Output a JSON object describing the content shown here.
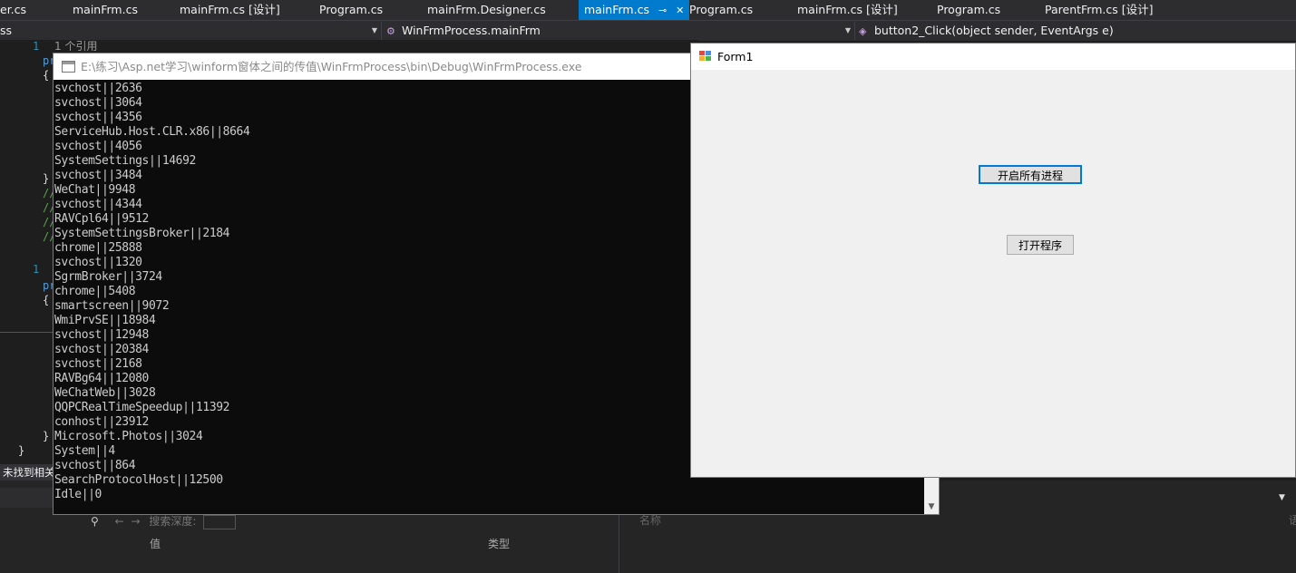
{
  "tabs": [
    {
      "label": "er.cs"
    },
    {
      "label": "mainFrm.cs"
    },
    {
      "label": "mainFrm.cs [设计]"
    },
    {
      "label": "Program.cs"
    },
    {
      "label": "mainFrm.Designer.cs"
    },
    {
      "label": "mainFrm.cs",
      "active": true
    },
    {
      "label": "Program.cs"
    },
    {
      "label": "mainFrm.cs [设计]"
    },
    {
      "label": "Program.cs"
    },
    {
      "label": "ParentFrm.cs [设计]"
    }
  ],
  "tab_pin_icon": "⊸",
  "tab_close_icon": "✕",
  "navbar": {
    "project": "ss",
    "type": "WinFrmProcess.mainFrm",
    "member": "button2_Click(object sender, EventArgs e)"
  },
  "editor": {
    "ref_text": "1 个引用",
    "line_numbers": [
      "1",
      "1"
    ],
    "fragments": [
      "pr",
      "{",
      "}",
      "//",
      "//",
      "//",
      "//",
      "pr",
      "{",
      "}",
      "}"
    ]
  },
  "status_left": "未找到相关",
  "lower_panel": {
    "search_depth_label": "搜索深度:",
    "col_value": "值",
    "col_type": "类型",
    "col_name": "名称",
    "col_lang": "语"
  },
  "console": {
    "title": "E:\\练习\\Asp.net学习\\winform窗体之间的传值\\WinFrmProcess\\bin\\Debug\\WinFrmProcess.exe",
    "lines": [
      "svchost||2636",
      "svchost||3064",
      "svchost||4356",
      "ServiceHub.Host.CLR.x86||8664",
      "svchost||4056",
      "SystemSettings||14692",
      "svchost||3484",
      "WeChat||9948",
      "svchost||4344",
      "RAVCpl64||9512",
      "SystemSettingsBroker||2184",
      "chrome||25888",
      "svchost||1320",
      "SgrmBroker||3724",
      "chrome||5408",
      "smartscreen||9072",
      "WmiPrvSE||18984",
      "svchost||12948",
      "svchost||20384",
      "svchost||2168",
      "RAVBg64||12080",
      "WeChatWeb||3028",
      "QQPCRealTimeSpeedup||11392",
      "conhost||23912",
      "Microsoft.Photos||3024",
      "System||4",
      "svchost||864",
      "SearchProtocolHost||12500",
      "Idle||0"
    ]
  },
  "form1": {
    "title": "Form1",
    "button_start_all": "开启所有进程",
    "button_open_program": "打开程序"
  }
}
